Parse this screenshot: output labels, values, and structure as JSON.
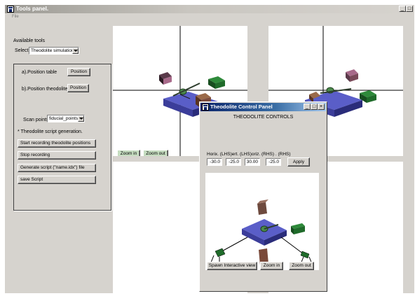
{
  "window": {
    "title": "Tools panel.",
    "menu_file": "File",
    "btn_minimize": "_",
    "btn_maximize": "□"
  },
  "left_panel": {
    "available_tools": "Available tools",
    "select_label": "Select",
    "select_value": "Theodolite simulation",
    "position_table_label": "a).Position table",
    "position_table_button": "Position",
    "position_theodolites_label": "b).Position theodolites",
    "position_theodolites_button": "Position",
    "scan_points_label": "Scan points",
    "scan_points_value": "fiducial_points",
    "script_generation_label": "* Theodolite script generation.",
    "start_recording_button": "Start recording theodolite positions",
    "stop_recording_button": "Stop recording",
    "generate_script_button": "Generate script (\"name.idx\") file",
    "save_script_button": "save Script"
  },
  "viewports": {
    "zoom_in": "Zoom in",
    "zoom_out": "Zoom out"
  },
  "theodolite_panel": {
    "title": "Theodolite Control Panel",
    "btn_minimize": "_",
    "btn_maximize": "□",
    "btn_close": "×",
    "heading": "THEODOLITE CONTROLS",
    "columns_label": "Horix. (LHS)ert. (LHS)oriz. (RHS) . (RHS)",
    "horiz_lhs": "-30.0",
    "vert_lhs": "-25.0",
    "horiz_rhs": "30.00",
    "vert_rhs": "-25.0",
    "apply_button": "Apply",
    "spawn_button": "Spawn Interactive view",
    "zoom_in": "Zoom in",
    "zoom_out": "Zoom out"
  },
  "colors": {
    "table_top": "#5a5ec8",
    "table_side": "#3b3d9a",
    "green_block": "#1f6b2a",
    "brown_block": "#7a4a3a",
    "pink_block": "#a86a8a",
    "theo_title_bar": "#0a246a"
  }
}
